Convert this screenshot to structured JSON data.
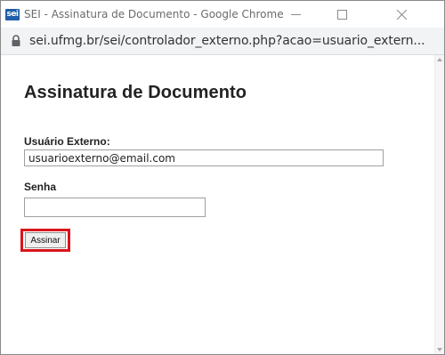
{
  "window": {
    "favicon_text": "sei",
    "title": "SEI - Assinatura de Documento - Google Chrome",
    "controls": {
      "minimize": "—",
      "maximize": "☐",
      "close": "✕"
    }
  },
  "addressbar": {
    "url": "sei.ufmg.br/sei/controlador_externo.php?acao=usuario_extern..."
  },
  "page": {
    "heading": "Assinatura de Documento",
    "user_label": "Usuário Externo:",
    "user_value": "usuarioexterno@email.com",
    "password_label": "Senha",
    "password_value": "",
    "sign_button": "Assinar"
  },
  "colors": {
    "highlight": "#d9141b",
    "favicon_bg": "#1f5ea8"
  }
}
